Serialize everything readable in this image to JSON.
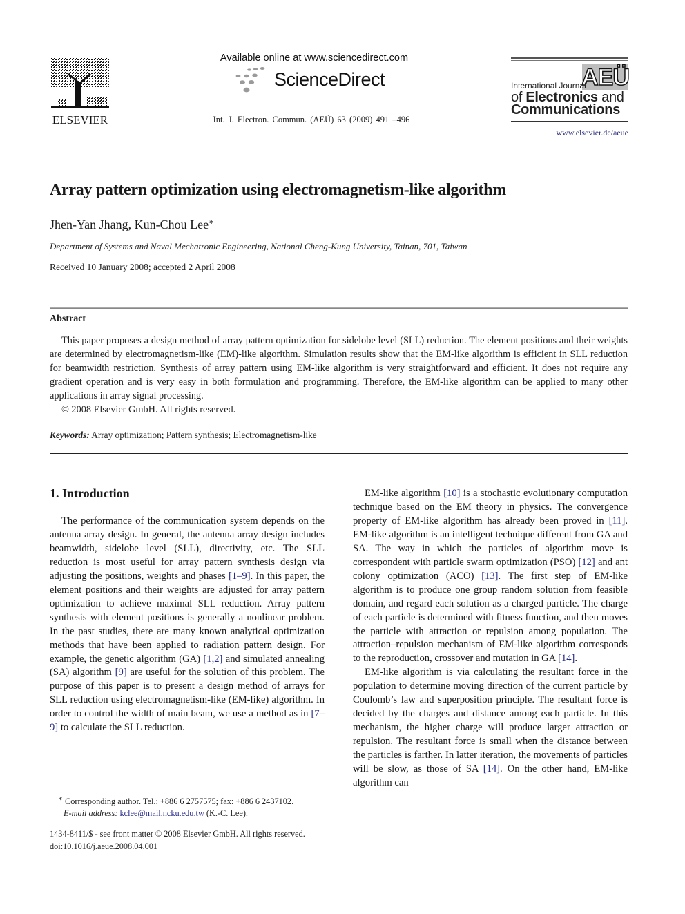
{
  "header": {
    "publisher_logo": {
      "icon": "elsevier-tree-icon",
      "wordmark": "ELSEVIER"
    },
    "availability": "Available online at www.sciencedirect.com",
    "sciencedirect_logo": {
      "icon": "sciencedirect-dots-icon",
      "wordmark": "ScienceDirect"
    },
    "citation": "Int. J. Electron. Commun. (AEÜ) 63 (2009) 491 –496",
    "journal_logo": {
      "badge": "AEÜ",
      "line1": "International Journal",
      "line2_prefix": "of ",
      "line2_bold": "Electronics",
      "line2_suffix": " and",
      "line3": "Communications"
    },
    "journal_url": "www.elsevier.de/aeue"
  },
  "article": {
    "title": "Array pattern optimization using electromagnetism-like algorithm",
    "authors": "Jhen-Yan Jhang, Kun-Chou Lee",
    "author_mark": "∗",
    "affiliation": "Department of Systems and Naval Mechatronic Engineering, National Cheng-Kung University, Tainan, 701, Taiwan",
    "received": "Received 10 January 2008; accepted 2 April 2008"
  },
  "abstract": {
    "heading": "Abstract",
    "body": "This paper proposes a design method of array pattern optimization for sidelobe level (SLL) reduction. The element positions and their weights are determined by electromagnetism-like (EM)-like algorithm. Simulation results show that the EM-like algorithm is efficient in SLL reduction for beamwidth restriction. Synthesis of array pattern using EM-like algorithm is very straightforward and efficient. It does not require any gradient operation and is very easy in both formulation and programming. Therefore, the EM-like algorithm can be applied to many other applications in array signal processing.",
    "copyright": "© 2008 Elsevier GmbH. All rights reserved.",
    "keywords_label": "Keywords:",
    "keywords": "Array optimization; Pattern synthesis; Electromagnetism-like"
  },
  "introduction": {
    "heading": "1.  Introduction",
    "left_para": [
      {
        "t": "The performance of the communication system depends on the antenna array design. In general, the antenna array design includes beamwidth, sidelobe level (SLL), directivity, etc. The SLL reduction is most useful for array pattern synthesis design via adjusting the positions, weights and phases "
      },
      {
        "r": "[1–9]"
      },
      {
        "t": ". In this paper, the element positions and their weights are adjusted for array pattern optimization to achieve maximal SLL reduction. Array pattern synthesis with element positions is generally a nonlinear problem. In the past studies, there are many known analytical optimization methods that have been applied to radiation pattern design. For example, the genetic algorithm (GA) "
      },
      {
        "r": "[1,2]"
      },
      {
        "t": " and simulated annealing (SA) algorithm "
      },
      {
        "r": "[9]"
      },
      {
        "t": " are useful for the solution of this problem. The purpose of this paper is to present a design method of arrays for SLL reduction using electromagnetism-like (EM-like) algorithm. In order to control the width of main beam, we use a method as in "
      },
      {
        "r": "[7–9]"
      },
      {
        "t": " to calculate the SLL reduction."
      }
    ],
    "right_para1": [
      {
        "t": "EM-like algorithm "
      },
      {
        "r": "[10]"
      },
      {
        "t": " is a stochastic evolutionary computation technique based on the EM theory in physics. The convergence property of EM-like algorithm has already been proved in "
      },
      {
        "r": "[11]"
      },
      {
        "t": ". EM-like algorithm is an intelligent technique different from GA and SA. The way in which the particles of algorithm move is correspondent with particle swarm optimization (PSO) "
      },
      {
        "r": "[12]"
      },
      {
        "t": " and ant colony optimization (ACO) "
      },
      {
        "r": "[13]"
      },
      {
        "t": ". The first step of EM-like algorithm is to produce one group random solution from feasible domain, and regard each solution as a charged particle. The charge of each particle is determined with fitness function, and then moves the particle with attraction or repulsion among population. The attraction–repulsion mechanism of EM-like algorithm corresponds to the reproduction, crossover and mutation in GA "
      },
      {
        "r": "[14]"
      },
      {
        "t": "."
      }
    ],
    "right_para2": [
      {
        "t": "EM-like algorithm is via calculating the resultant force in the population to determine moving direction of the current particle by Coulomb’s law and superposition principle. The resultant force is decided by the charges and distance among each particle. In this mechanism, the higher charge will produce larger attraction or repulsion. The resultant force is small when the distance between the particles is farther. In latter iteration, the movements of particles will be slow, as those of SA "
      },
      {
        "r": "[14]"
      },
      {
        "t": ". On the other hand, EM-like algorithm can"
      }
    ]
  },
  "footnotes": {
    "corresponding_mark": "∗",
    "corresponding": " Corresponding author. Tel.: +886 6 2757575; fax: +886 6 2437102.",
    "email_label": "E-mail address:",
    "email": "kclee@mail.ncku.edu.tw",
    "email_suffix": " (K.-C. Lee).",
    "issn_line": "1434-8411/$ - see front matter © 2008 Elsevier GmbH. All rights reserved.",
    "doi": "doi:10.1016/j.aeue.2008.04.001"
  },
  "colors": {
    "link": "#262a8a",
    "text": "#1a1a1a",
    "aeu_badge_bg": "#bdbdbd"
  }
}
